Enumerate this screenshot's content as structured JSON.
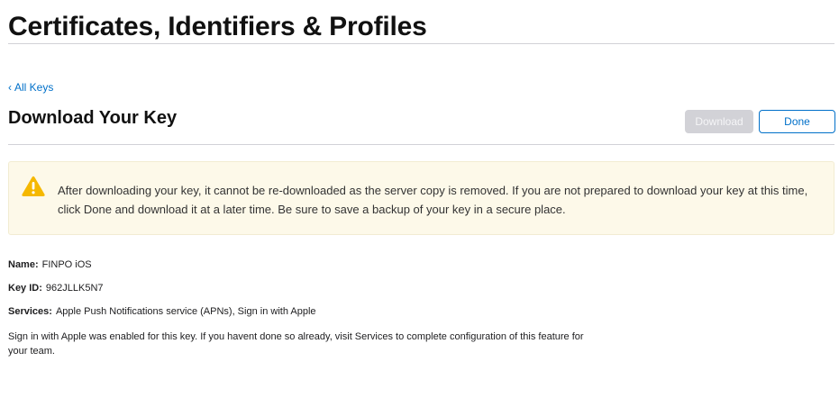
{
  "header": {
    "title": "Certificates, Identifiers & Profiles"
  },
  "nav": {
    "back_chevron": "‹",
    "back_label": "All Keys"
  },
  "section": {
    "title": "Download Your Key"
  },
  "buttons": {
    "download_label": "Download",
    "done_label": "Done",
    "download_enabled": false
  },
  "warning": {
    "icon": "warning-triangle-icon",
    "text": "After downloading your key, it cannot be re-downloaded as the server copy is removed. If you are not prepared to download your key at this time, click Done and download it at a later time. Be sure to save a backup of your key in a secure place."
  },
  "details": {
    "name_label": "Name:",
    "name_value": "FINPO iOS",
    "keyid_label": "Key ID:",
    "keyid_value": "962JLLK5N7",
    "services_label": "Services:",
    "services_value": "Apple Push Notifications service (APNs), Sign in with Apple"
  },
  "note": "Sign in with Apple was enabled for this key. If you havent done so already, visit Services to complete configuration of this feature for your team.",
  "colors": {
    "accent": "#0070c9",
    "warning": "#f5b800",
    "warning_bg": "#fdf9e9",
    "disabled_button": "#d2d2d7"
  }
}
